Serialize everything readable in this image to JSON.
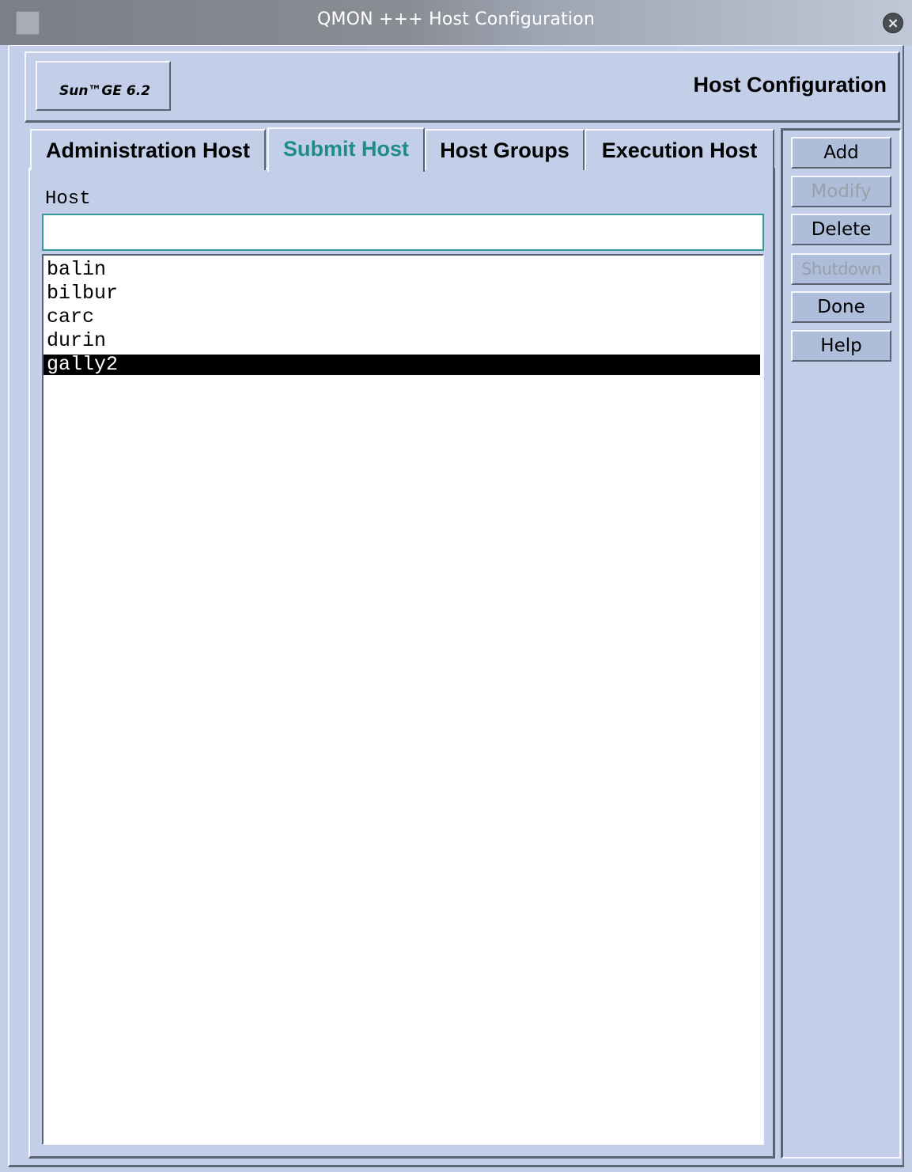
{
  "window": {
    "title": "QMON  +++  Host Configuration",
    "close_glyph": "×"
  },
  "header": {
    "logo_text": "Sun™GE 6.2",
    "title": "Host Configuration"
  },
  "tabs": [
    {
      "label": "Administration Host",
      "active": false
    },
    {
      "label": "Submit Host",
      "active": true
    },
    {
      "label": "Host Groups",
      "active": false
    },
    {
      "label": "Execution Host",
      "active": false
    }
  ],
  "host_field": {
    "label": "Host",
    "value": ""
  },
  "host_list": {
    "items": [
      "balin",
      "bilbur",
      "carc",
      "durin",
      "gally2"
    ],
    "selected": "gally2"
  },
  "buttons": {
    "add": "Add",
    "modify": "Modify",
    "delete": "Delete",
    "shutdown": "Shutdown",
    "done": "Done",
    "help": "Help"
  },
  "colors": {
    "background": "#c3cfe8",
    "button": "#aebdda",
    "active_tab_text": "#1f8c8c",
    "selection": "#000000"
  }
}
